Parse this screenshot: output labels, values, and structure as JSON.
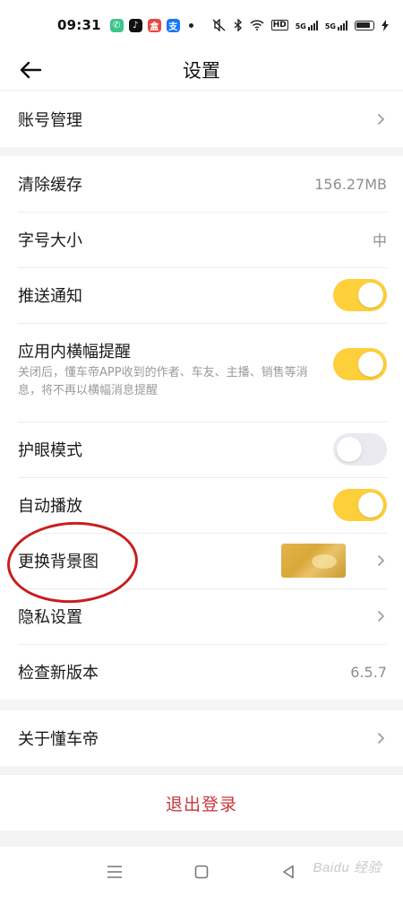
{
  "status_bar": {
    "time": "09:31",
    "app_icons": [
      {
        "name": "phone-app-icon",
        "color": "#3cc48b",
        "glyph": "✆"
      },
      {
        "name": "tiktok-app-icon",
        "color": "#111111",
        "glyph": "♪"
      },
      {
        "name": "shopping-app-icon",
        "color": "#e8473e",
        "glyph": "盒"
      },
      {
        "name": "alipay-app-icon",
        "color": "#1677ff",
        "glyph": "支"
      }
    ],
    "net_label": "HD",
    "signal_1": "5G",
    "signal_2": "5G"
  },
  "nav": {
    "title": "设置"
  },
  "groups": {
    "account": {
      "label": "账号管理"
    },
    "settings": {
      "clear_cache": {
        "label": "清除缓存",
        "value": "156.27MB"
      },
      "font_size": {
        "label": "字号大小",
        "value": "中"
      },
      "push": {
        "label": "推送通知",
        "on": true
      },
      "banner": {
        "label": "应用内横幅提醒",
        "desc": "关闭后，懂车帝APP收到的作者、车友、主播、销售等消息，将不再以横幅消息提醒",
        "on": true
      },
      "eye_care": {
        "label": "护眼模式",
        "on": false
      },
      "autoplay": {
        "label": "自动播放",
        "on": true
      },
      "background": {
        "label": "更换背景图"
      },
      "privacy": {
        "label": "隐私设置"
      },
      "version": {
        "label": "检查新版本",
        "value": "6.5.7"
      }
    },
    "about": {
      "label": "关于懂车帝"
    }
  },
  "logout": {
    "label": "退出登录"
  },
  "watermark": "Baidu 经验",
  "colors": {
    "toggle_on": "#fdcf3b",
    "toggle_off": "#e9e9ef",
    "logout_text": "#c8373b",
    "annotation_circle": "#c81e1e"
  }
}
